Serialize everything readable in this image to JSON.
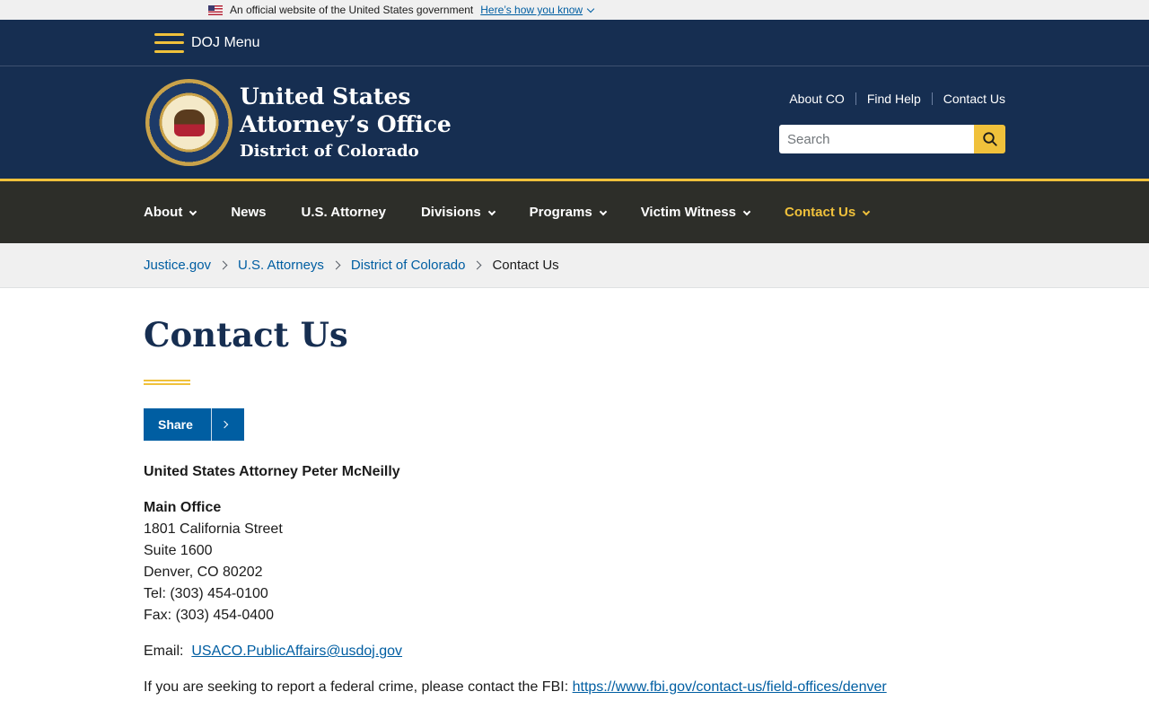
{
  "gov_banner": {
    "text": "An official website of the United States government",
    "link": "Here’s how you know"
  },
  "topbar": {
    "menu_label": "DOJ Menu"
  },
  "header": {
    "title_line1": "United States",
    "title_line2": "Attorney’s Office",
    "title_line3": "District of Colorado",
    "utility_links": [
      "About CO",
      "Find Help",
      "Contact Us"
    ],
    "search_placeholder": "Search"
  },
  "mainnav": {
    "items": [
      {
        "label": "About",
        "dropdown": true
      },
      {
        "label": "News",
        "dropdown": false
      },
      {
        "label": "U.S. Attorney",
        "dropdown": false
      },
      {
        "label": "Divisions",
        "dropdown": true
      },
      {
        "label": "Programs",
        "dropdown": true
      },
      {
        "label": "Victim Witness",
        "dropdown": true
      },
      {
        "label": "Contact Us",
        "dropdown": true,
        "active": true
      }
    ]
  },
  "breadcrumb": {
    "items": [
      "Justice.gov",
      "U.S. Attorneys",
      "District of Colorado"
    ],
    "current": "Contact Us"
  },
  "content": {
    "title": "Contact Us",
    "share_label": "Share",
    "attorney": "United States Attorney Peter McNeilly",
    "office_label": "Main Office",
    "address_lines": [
      "1801 California Street",
      "Suite 1600",
      "Denver, CO 80202",
      "Tel: (303) 454-0100",
      "Fax: (303) 454-0400"
    ],
    "email_label": "Email:",
    "email": "USACO.PublicAffairs@usdoj.gov",
    "fbi_text": "If you are seeking to report a federal crime, please contact the FBI:",
    "fbi_link": "https://www.fbi.gov/contact-us/field-offices/denver"
  },
  "colors": {
    "navy": "#162e51",
    "gold": "#f0c13b",
    "nav_dark": "#2d2e29",
    "link": "#005ea2"
  }
}
